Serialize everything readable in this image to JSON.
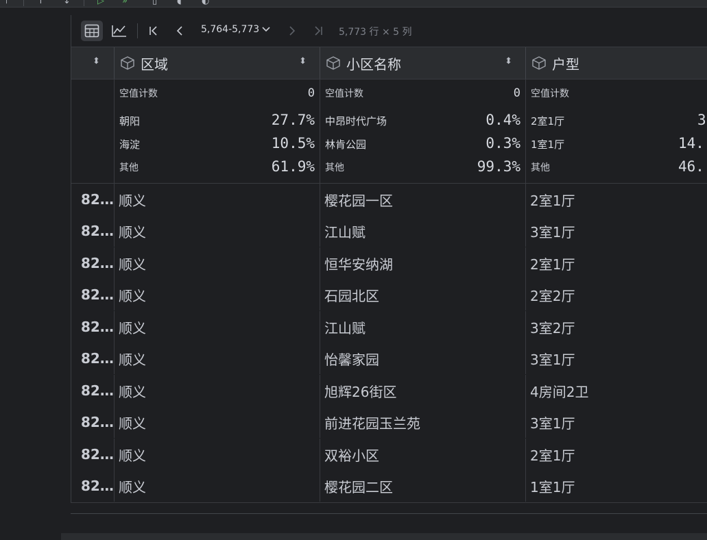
{
  "toolbar": {
    "range_label": "5,764-5,773",
    "dims_label": "5,773 行 × 5 列",
    "icons": [
      "table-view-icon",
      "chart-view-icon",
      "first-page-icon",
      "prev-page-icon",
      "next-page-icon",
      "last-page-icon"
    ]
  },
  "columns": [
    {
      "name": "区域"
    },
    {
      "name": "小区名称"
    },
    {
      "name": "户型"
    }
  ],
  "stats": [
    {
      "null_label": "空值计数",
      "null_value": "0",
      "top": [
        {
          "label": "朝阳",
          "pct": "27.7%"
        },
        {
          "label": "海淀",
          "pct": "10.5%"
        },
        {
          "label": "其他",
          "pct": "61.9%"
        }
      ]
    },
    {
      "null_label": "空值计数",
      "null_value": "0",
      "top": [
        {
          "label": "中昂时代广场",
          "pct": "0.4%"
        },
        {
          "label": "林肯公园",
          "pct": "0.3%"
        },
        {
          "label": "其他",
          "pct": "99.3%"
        }
      ]
    },
    {
      "null_label": "空值计数",
      "null_value": "",
      "top": [
        {
          "label": "2室1厅",
          "pct": "3"
        },
        {
          "label": "1室1厅",
          "pct": "14."
        },
        {
          "label": "其他",
          "pct": "46."
        }
      ]
    }
  ],
  "rows": [
    {
      "idx": "82…",
      "c1": "顺义",
      "c2": "樱花园一区",
      "c3": "2室1厅"
    },
    {
      "idx": "82…",
      "c1": "顺义",
      "c2": "江山赋",
      "c3": "3室1厅"
    },
    {
      "idx": "82…",
      "c1": "顺义",
      "c2": "恒华安纳湖",
      "c3": "2室1厅"
    },
    {
      "idx": "82…",
      "c1": "顺义",
      "c2": "石园北区",
      "c3": "2室2厅"
    },
    {
      "idx": "82…",
      "c1": "顺义",
      "c2": "江山赋",
      "c3": "3室2厅"
    },
    {
      "idx": "82…",
      "c1": "顺义",
      "c2": "怡馨家园",
      "c3": "3室1厅"
    },
    {
      "idx": "82…",
      "c1": "顺义",
      "c2": "旭辉26街区",
      "c3": "4房间2卫"
    },
    {
      "idx": "82…",
      "c1": "顺义",
      "c2": "前进花园玉兰苑",
      "c3": "3室1厅"
    },
    {
      "idx": "82…",
      "c1": "顺义",
      "c2": "双裕小区",
      "c3": "2室1厅"
    },
    {
      "idx": "82…",
      "c1": "顺义",
      "c2": "樱花园二区",
      "c3": "1室1厅"
    }
  ]
}
